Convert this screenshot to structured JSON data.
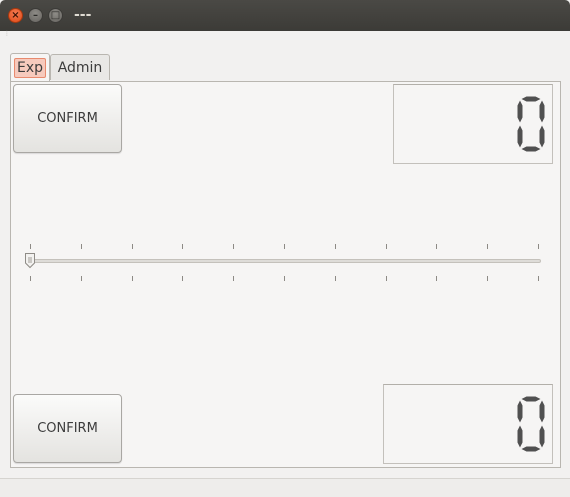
{
  "window": {
    "title": "---",
    "close_glyph": "×",
    "minimize_glyph": "–",
    "maximize_glyph": "□"
  },
  "tabs": [
    {
      "label": "Exp",
      "active": true
    },
    {
      "label": "Admin",
      "active": false
    }
  ],
  "exp": {
    "top_button_label": "CONFIRM",
    "bottom_button_label": "CONFIRM",
    "top_display_value": "0",
    "bottom_display_value": "0",
    "slider": {
      "value": 0,
      "min": 0,
      "max": 10,
      "tick_count": 11
    }
  },
  "colors": {
    "close_button": "#df4a16",
    "active_tab_highlight": "#f6cabd",
    "lcd_segment": "#505050"
  }
}
